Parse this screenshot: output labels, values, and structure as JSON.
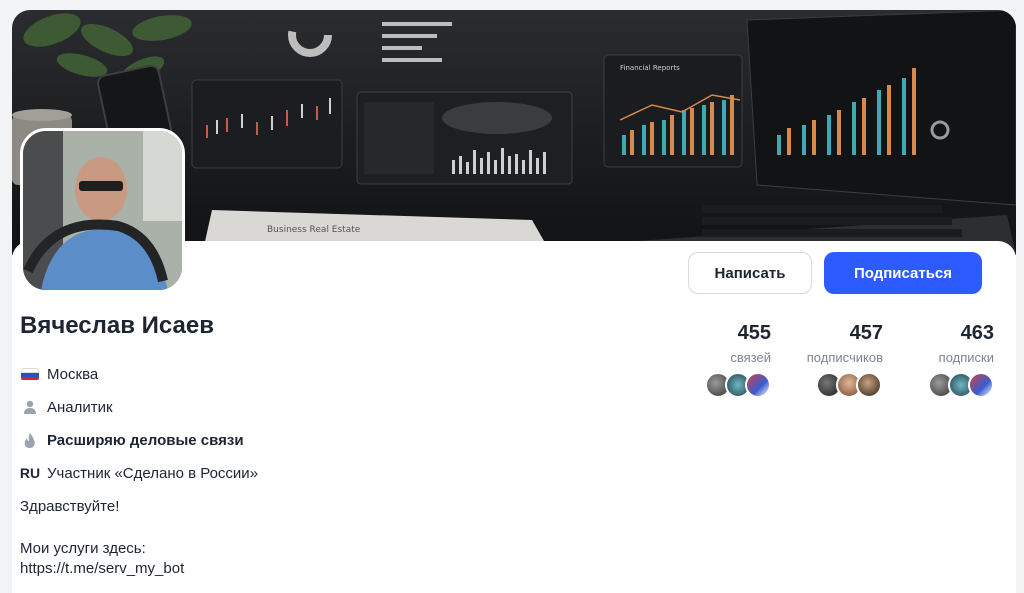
{
  "profile": {
    "name": "Вячеслав Исаев",
    "city": "Москва",
    "position": "Аналитик",
    "goal": "Расширяю деловые связи",
    "badge_code": "RU",
    "badge_text": "Участник «Сделано в России»",
    "greeting": "Здравствуйте!",
    "services_label": "Мои услуги здесь:",
    "services_link": "https://t.me/serv_my_bot"
  },
  "actions": {
    "write_label": "Написать",
    "subscribe_label": "Подписаться"
  },
  "stats": [
    {
      "value": "455",
      "label": "связей"
    },
    {
      "value": "457",
      "label": "подписчиков"
    },
    {
      "value": "463",
      "label": "подписки"
    }
  ],
  "banner_text": {
    "paper_heading": "Business Real Estate",
    "chart_heading": "Financial Reports"
  },
  "colors": {
    "accent": "#2e5bff",
    "text": "#1d2533",
    "muted": "#7b8492",
    "chart_teal": "#3fa9b5",
    "chart_orange": "#d98a4b"
  },
  "icons": {
    "city": "russia-flag-icon",
    "position": "person-icon",
    "goal": "flame-icon"
  }
}
